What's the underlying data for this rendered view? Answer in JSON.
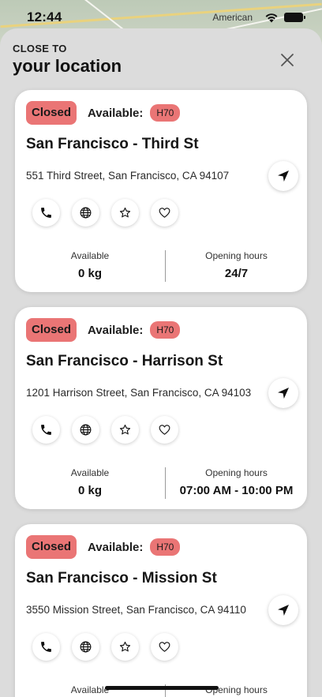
{
  "status_bar": {
    "time": "12:44",
    "map_label": "American"
  },
  "sheet": {
    "overline": "CLOSE TO",
    "title": "your location"
  },
  "colors": {
    "closed_badge": "#ea7575",
    "sheet_bg": "#dcdcdc"
  },
  "icons": {
    "close": "close-icon",
    "navigate": "navigation-arrow-icon",
    "phone": "phone-icon",
    "web": "globe-icon",
    "favorite": "star-icon",
    "like": "heart-icon"
  },
  "stations": [
    {
      "status": "Closed",
      "available_label": "Available:",
      "fuel": "H70",
      "name": "San Francisco - Third St",
      "address": "551 Third Street, San Francisco, CA 94107",
      "stat_available_label": "Available",
      "stat_available_value": "0 kg",
      "stat_hours_label": "Opening hours",
      "stat_hours_value": "24/7"
    },
    {
      "status": "Closed",
      "available_label": "Available:",
      "fuel": "H70",
      "name": "San Francisco - Harrison St",
      "address": "1201 Harrison Street, San Francisco, CA 94103",
      "stat_available_label": "Available",
      "stat_available_value": "0 kg",
      "stat_hours_label": "Opening hours",
      "stat_hours_value": "07:00 AM - 10:00 PM"
    },
    {
      "status": "Closed",
      "available_label": "Available:",
      "fuel": "H70",
      "name": "San Francisco - Mission St",
      "address": "3550 Mission Street, San Francisco, CA 94110",
      "stat_available_label": "Available",
      "stat_available_value": "",
      "stat_hours_label": "Opening hours",
      "stat_hours_value": ""
    }
  ]
}
